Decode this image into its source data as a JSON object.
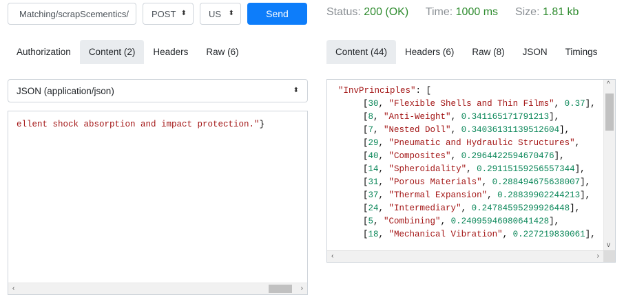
{
  "request": {
    "url": "/Matching/scrapScementics",
    "method": "POST",
    "region": "US",
    "send_label": "Send",
    "tabs": [
      {
        "label": "Authorization",
        "active": false
      },
      {
        "label": "Content (2)",
        "active": true
      },
      {
        "label": "Headers",
        "active": false
      },
      {
        "label": "Raw (6)",
        "active": false
      }
    ],
    "content_type": "JSON (application/json)",
    "body_text": "ellent shock absorption and impact protection.\"",
    "body_closing": "}"
  },
  "response": {
    "status_label": "Status:",
    "status_value": "200 (OK)",
    "time_label": "Time:",
    "time_value": "1000 ms",
    "size_label": "Size:",
    "size_value": "1.81 kb",
    "tabs": [
      {
        "label": "Content (44)",
        "active": true
      },
      {
        "label": "Headers (6)",
        "active": false
      },
      {
        "label": "Raw (8)",
        "active": false
      },
      {
        "label": "JSON",
        "active": false
      },
      {
        "label": "Timings",
        "active": false
      }
    ],
    "json_key": "\"InvPrinciples\"",
    "json_key_suffix": ": [",
    "rows": [
      {
        "id": "30",
        "name": "\"Flexible Shells and Thin Films\"",
        "score": "0.37"
      },
      {
        "id": "8",
        "name": "\"Anti-Weight\"",
        "score": "0.341165171791213"
      },
      {
        "id": "7",
        "name": "\"Nested Doll\"",
        "score": "0.34036131139512604"
      },
      {
        "id": "29",
        "name": "\"Pneumatic and Hydraulic Structures\"",
        "score": ""
      },
      {
        "id": "40",
        "name": "\"Composites\"",
        "score": "0.2964422594670476"
      },
      {
        "id": "14",
        "name": "\"Spheroidality\"",
        "score": "0.29115159256557344"
      },
      {
        "id": "31",
        "name": "\"Porous Materials\"",
        "score": "0.288494675638007"
      },
      {
        "id": "37",
        "name": "\"Thermal Expansion\"",
        "score": "0.28839902244213"
      },
      {
        "id": "24",
        "name": "\"Intermediary\"",
        "score": "0.24784595299926448"
      },
      {
        "id": "5",
        "name": "\"Combining\"",
        "score": "0.24095946080641428"
      },
      {
        "id": "18",
        "name": "\"Mechanical Vibration\"",
        "score": "0.227219830061"
      }
    ]
  },
  "icons": {
    "updown": "⬍",
    "left_arrow": "‹",
    "right_arrow": "›",
    "up_arrow": "^",
    "down_arrow": "v"
  }
}
